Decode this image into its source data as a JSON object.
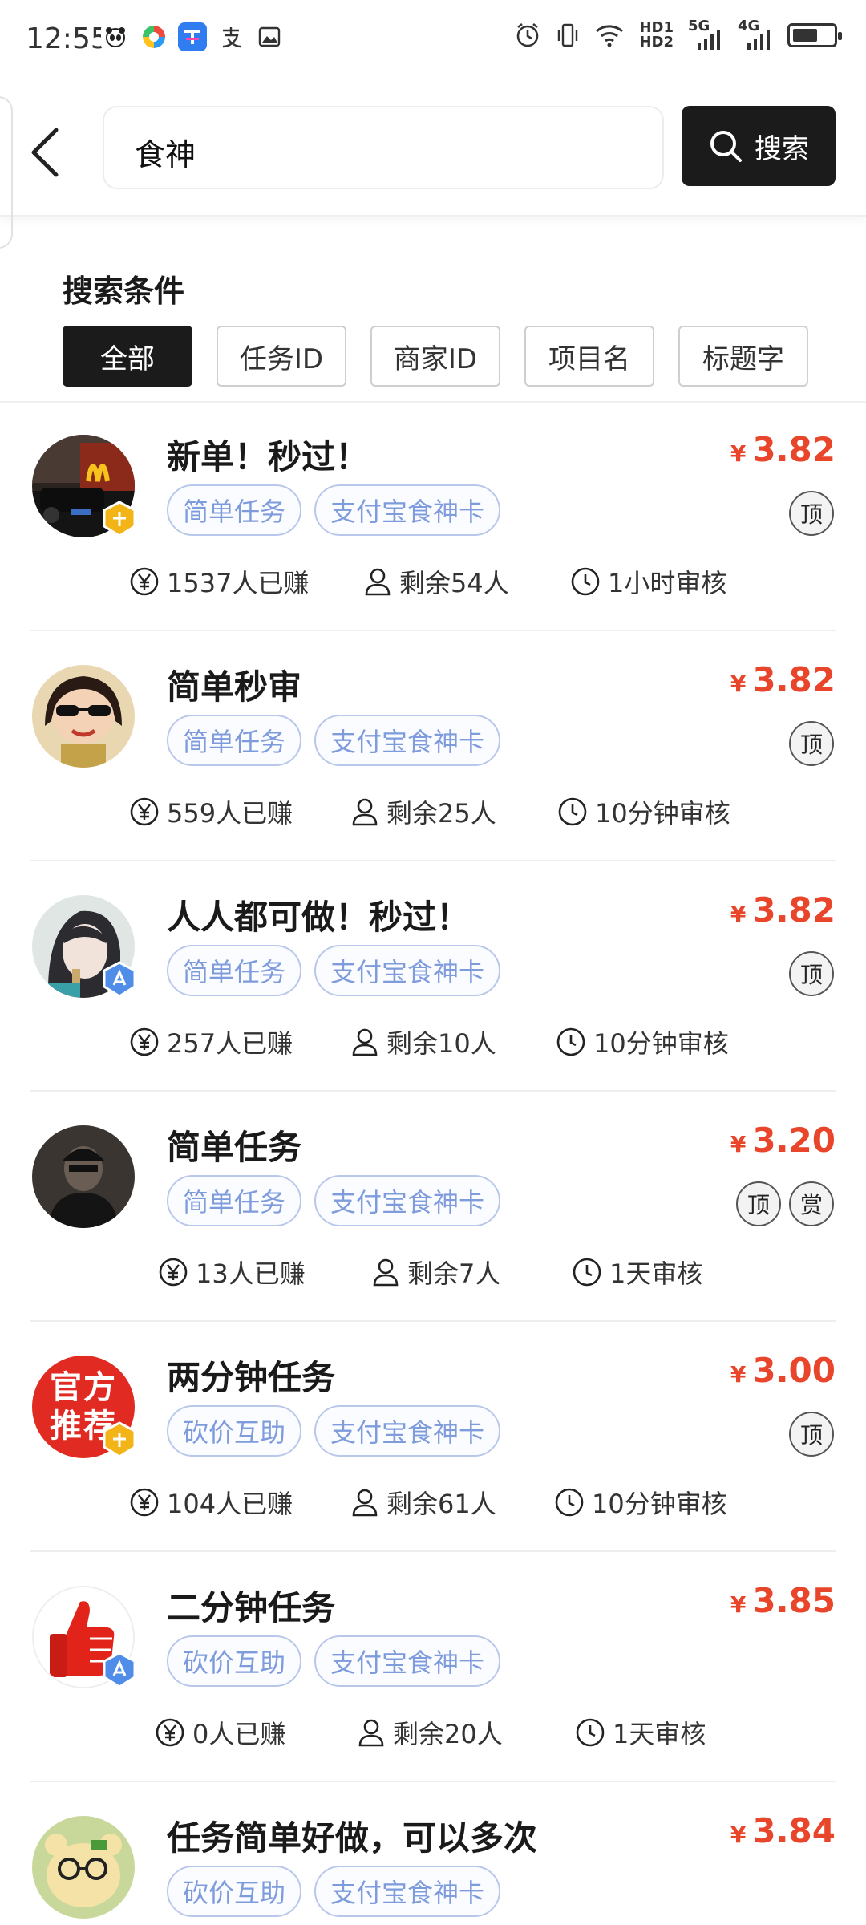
{
  "status_bar": {
    "time": "12:55",
    "network": "5G",
    "network2": "4G",
    "hd1": "HD1",
    "hd2": "HD2",
    "app_icons": [
      "panda-app-icon",
      "colorful-app-icon",
      "blue-app-icon",
      "alipay-icon",
      "gallery-icon"
    ]
  },
  "search": {
    "query": "食神",
    "button_label": "搜索"
  },
  "filter": {
    "title": "搜索条件",
    "chips": [
      {
        "label": "全部",
        "active": true
      },
      {
        "label": "任务ID",
        "active": false
      },
      {
        "label": "商家ID",
        "active": false
      },
      {
        "label": "项目名",
        "active": false
      },
      {
        "label": "标题字",
        "active": false
      }
    ]
  },
  "tasks": [
    {
      "title": "新单！秒过！",
      "price": "3.82",
      "tags": [
        "简单任务",
        "支付宝食神卡"
      ],
      "pills": [
        "顶"
      ],
      "earned": "1537人已赚",
      "remaining": "剩余54人",
      "review": "1小时审核",
      "avatar": "mcdonalds-storefront",
      "badge": "gold"
    },
    {
      "title": "简单秒审",
      "price": "3.82",
      "tags": [
        "简单任务",
        "支付宝食神卡"
      ],
      "pills": [
        "顶"
      ],
      "earned": "559人已赚",
      "remaining": "剩余25人",
      "review": "10分钟审核",
      "avatar": "cartoon-girl",
      "badge": "none"
    },
    {
      "title": "人人都可做！秒过！",
      "price": "3.82",
      "tags": [
        "简单任务",
        "支付宝食神卡"
      ],
      "pills": [
        "顶"
      ],
      "earned": "257人已赚",
      "remaining": "剩余10人",
      "review": "10分钟审核",
      "avatar": "girl-photo",
      "badge": "blue"
    },
    {
      "title": "简单任务",
      "price": "3.20",
      "tags": [
        "简单任务",
        "支付宝食神卡"
      ],
      "pills": [
        "顶",
        "赏"
      ],
      "earned": "13人已赚",
      "remaining": "剩余7人",
      "review": "1天审核",
      "avatar": "dark-man",
      "badge": "none"
    },
    {
      "title": "两分钟任务",
      "price": "3.00",
      "tags": [
        "砍价互助",
        "支付宝食神卡"
      ],
      "pills": [
        "顶"
      ],
      "earned": "104人已赚",
      "remaining": "剩余61人",
      "review": "10分钟审核",
      "avatar": "official-recommend",
      "avatar_text": "官方推荐",
      "badge": "gold"
    },
    {
      "title": "二分钟任务",
      "price": "3.85",
      "tags": [
        "砍价互助",
        "支付宝食神卡"
      ],
      "pills": [],
      "earned": "0人已赚",
      "remaining": "剩余20人",
      "review": "1天审核",
      "avatar": "thumbs-up",
      "badge": "blue"
    },
    {
      "title": "任务简单好做，可以多次",
      "price": "3.84",
      "tags": [
        "砍价互助",
        "支付宝食神卡"
      ],
      "pills": [],
      "earned": "",
      "remaining": "",
      "review": "",
      "avatar": "cartoon-bear",
      "badge": "none"
    }
  ],
  "currency_symbol": "¥",
  "colors": {
    "accent": "#e8452a",
    "tag": "#7e9bdc",
    "dark_button": "#1b1b1b"
  }
}
